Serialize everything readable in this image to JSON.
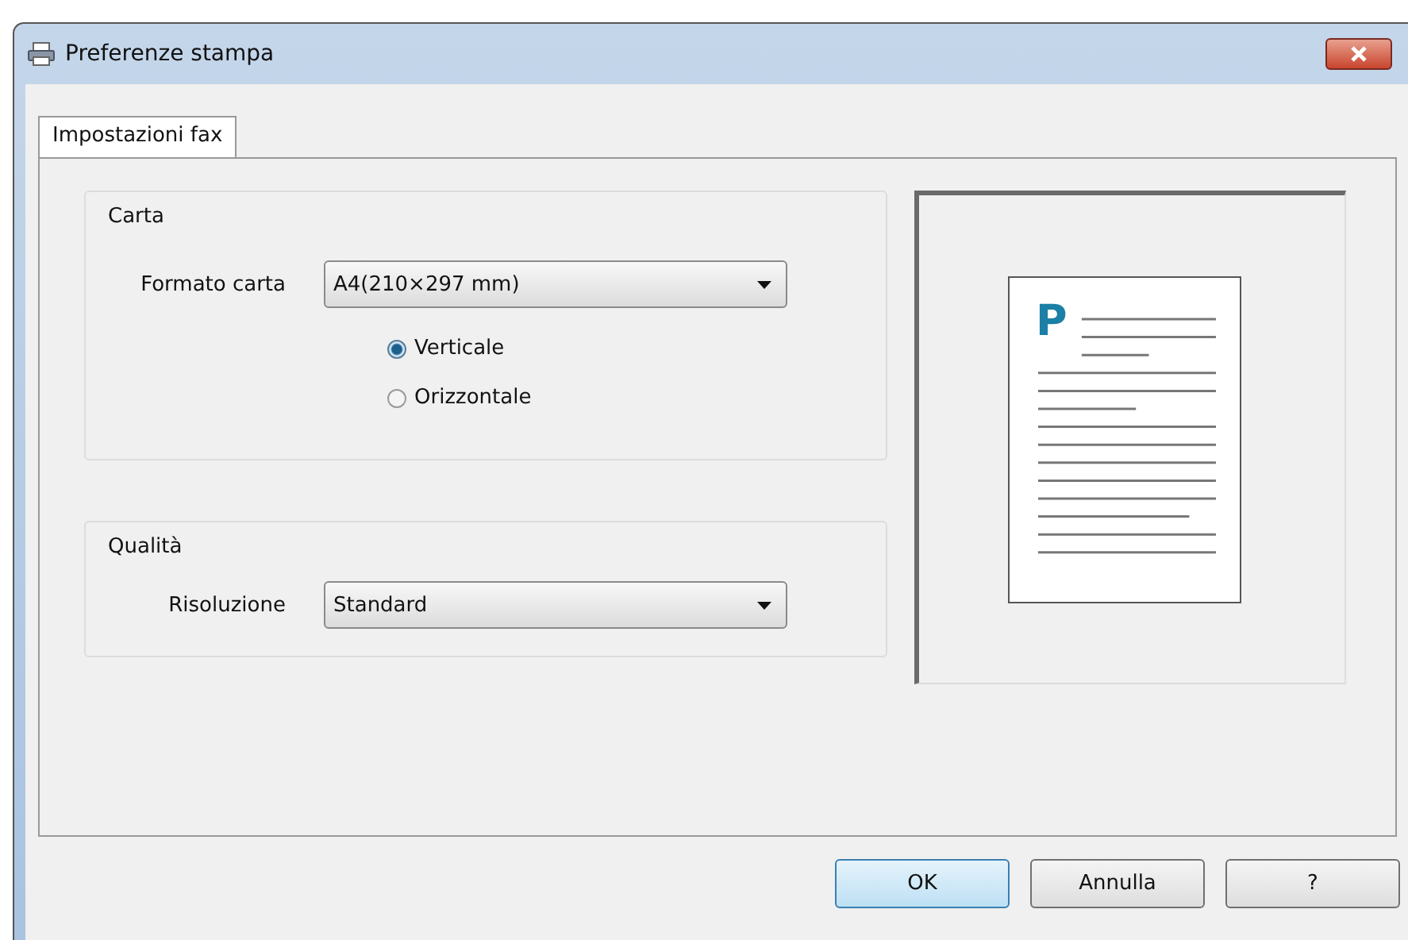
{
  "window": {
    "title": "Preferenze stampa"
  },
  "tabs": [
    {
      "label": "Impostazioni fax",
      "selected": true
    }
  ],
  "paper_group": {
    "title": "Carta",
    "size_label": "Formato carta",
    "size_value": "A4(210×297 mm)",
    "orientation": [
      {
        "label": "Verticale",
        "selected": true
      },
      {
        "label": "Orizzontale",
        "selected": false
      }
    ]
  },
  "quality_group": {
    "title": "Qualità",
    "resolution_label": "Risoluzione",
    "resolution_value": "Standard"
  },
  "preview": {
    "letter": "P"
  },
  "buttons": [
    {
      "label": "OK",
      "kind": "default"
    },
    {
      "label": "Annulla",
      "kind": "normal"
    },
    {
      "label": "?",
      "kind": "normal"
    }
  ]
}
